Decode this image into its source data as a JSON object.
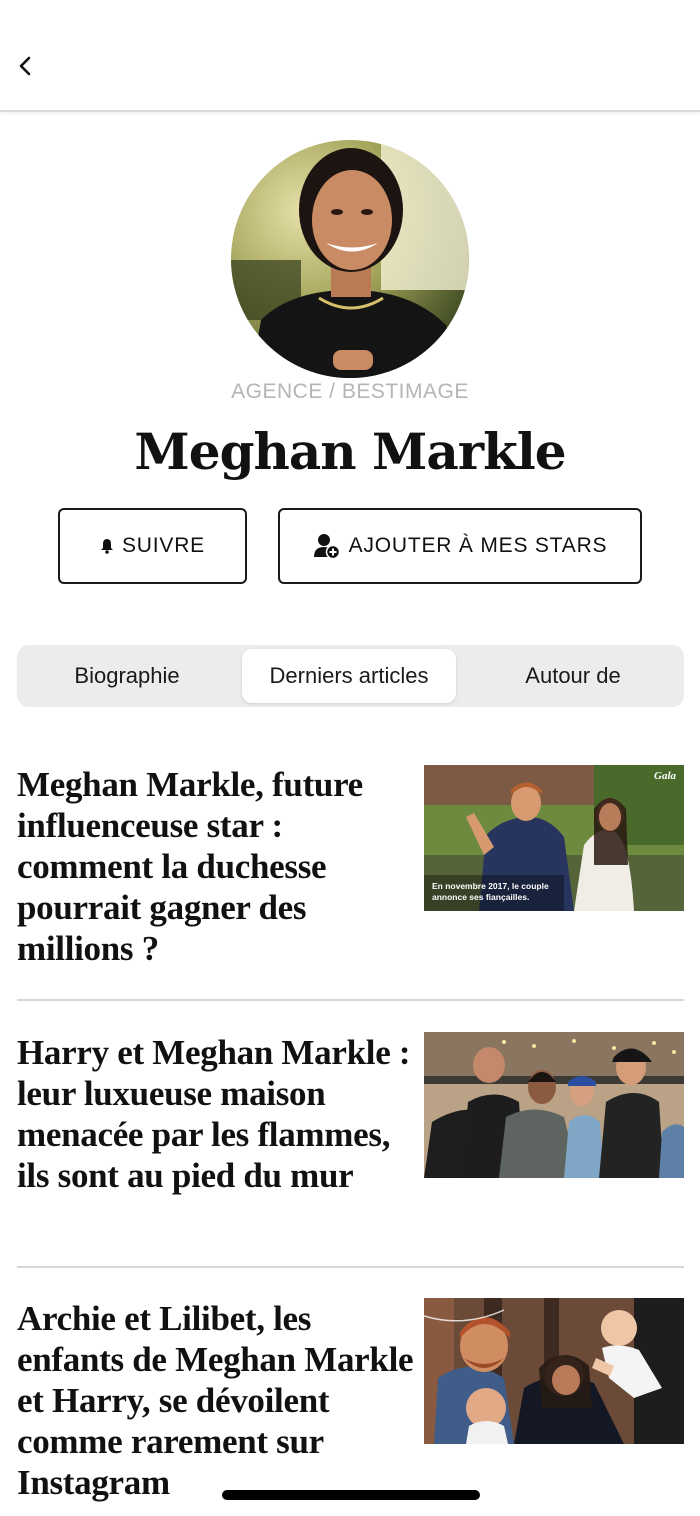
{
  "header": {
    "back_icon": "chevron-left-icon"
  },
  "profile": {
    "photo_credit": "AGENCE / BESTIMAGE",
    "name": "Meghan Markle"
  },
  "actions": {
    "follow_label": "SUIVRE",
    "follow_icon": "bell-icon",
    "add_star_label": "AJOUTER À MES STARS",
    "add_star_icon": "add-user-icon"
  },
  "tabs": [
    {
      "label": "Biographie",
      "selected": false
    },
    {
      "label": "Derniers articles",
      "selected": true
    },
    {
      "label": "Autour de",
      "selected": false
    }
  ],
  "articles": [
    {
      "title": "Meghan Markle, future influenceuse star : comment la duchesse pourrait gagner des millions ?",
      "image_caption": "En novembre 2017, le couple annonce ses fiançailles.",
      "image_logo": "Gala"
    },
    {
      "title": "Harry et Meghan Markle : leur luxueuse maison menacée par les flammes, ils sont au pied du mur"
    },
    {
      "title": "Archie et Lilibet, les enfants de Meghan Markle et Harry, se dévoilent comme rarement sur Instagram"
    }
  ],
  "colors": {
    "accent_text": "#111111",
    "tab_background": "#ececec",
    "divider": "#d6d6d6",
    "credit_text": "#b5b5b5"
  }
}
